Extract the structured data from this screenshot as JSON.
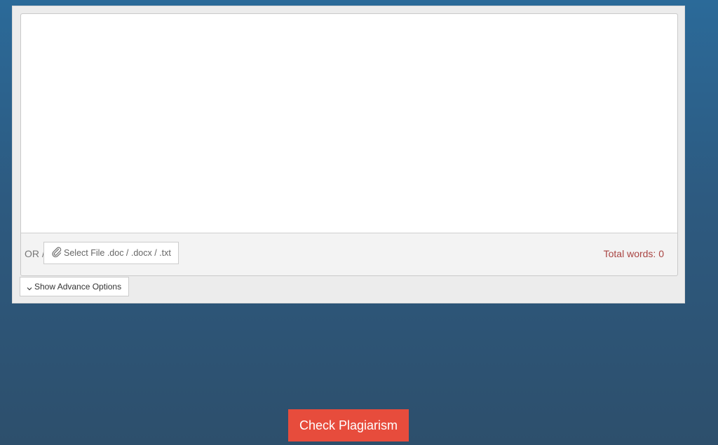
{
  "editor": {
    "text_value": "",
    "placeholder": ""
  },
  "footer": {
    "or_label": "OR /",
    "file_button_label": "Select File .doc / .docx / .txt",
    "word_count_label": "Total words: 0"
  },
  "options": {
    "advance_label": "Show Advance Options"
  },
  "actions": {
    "check_label": "Check Plagiarism"
  },
  "icons": {
    "file": "paperclip-icon",
    "advance": "chevron-down-icon"
  },
  "colors": {
    "check_button": "#e74c3c",
    "word_count": "#a94442",
    "background_top": "#2b6a99",
    "background_bottom": "#2d4f6c"
  }
}
